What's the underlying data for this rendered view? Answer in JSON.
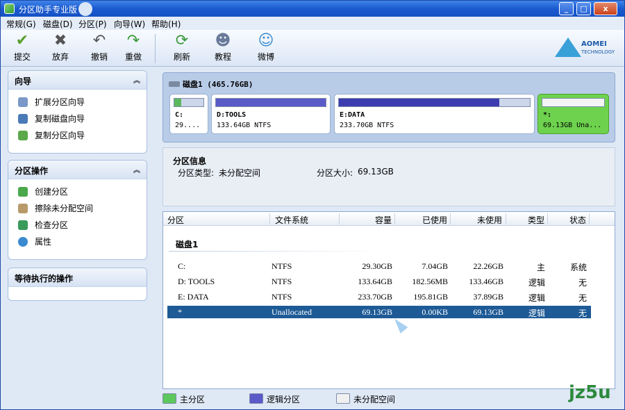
{
  "window": {
    "title": "分区助手专业版",
    "controls": [
      "_",
      "□",
      "x"
    ]
  },
  "menu": [
    "常规(G)",
    "磁盘(D)",
    "分区(P)",
    "向导(W)",
    "帮助(H)"
  ],
  "toolbar": [
    {
      "label": "提交",
      "icon": "check-icon"
    },
    {
      "label": "放弃",
      "icon": "x-icon"
    },
    {
      "label": "撤销",
      "icon": "undo-icon"
    },
    {
      "label": "重做",
      "icon": "redo-icon"
    },
    {
      "label": "刷新",
      "icon": "refresh-icon"
    },
    {
      "label": "教程",
      "icon": "tutorial-icon"
    },
    {
      "label": "微博",
      "icon": "weibo-icon"
    }
  ],
  "logo": {
    "line1": "AOMEI",
    "line2": "TECHNOLOGY"
  },
  "sidebar": {
    "wizard": {
      "title": "向导",
      "items": [
        "扩展分区向导",
        "复制磁盘向导",
        "复制分区向导"
      ]
    },
    "ops": {
      "title": "分区操作",
      "items": [
        "创建分区",
        "擦除未分配空间",
        "检查分区",
        "属性"
      ]
    },
    "pending": {
      "title": "等待执行的操作"
    }
  },
  "disk": {
    "title": "磁盘1  (465.76GB)",
    "partitions": [
      {
        "name": "C:",
        "size": "29....",
        "fill": 0.24,
        "color": "#5cb85c"
      },
      {
        "name": "D:TOOLS",
        "size": "133.64GB NTFS",
        "fill": 1.0,
        "color": "#5a5ac8"
      },
      {
        "name": "E:DATA",
        "size": "233.70GB NTFS",
        "fill": 0.84,
        "color": "#3c3cb0"
      },
      {
        "name": "*:",
        "size": "69.13GB Una...",
        "fill": 0.0,
        "color": "#ffffff"
      }
    ]
  },
  "info": {
    "title": "分区信息",
    "type_label": "分区类型:",
    "type_value": "未分配空间",
    "size_label": "分区大小:",
    "size_value": "69.13GB"
  },
  "table": {
    "headers": [
      "分区",
      "文件系统",
      "容量",
      "已使用",
      "未使用",
      "类型",
      "状态"
    ],
    "group": "磁盘1",
    "rows": [
      [
        "C:",
        "NTFS",
        "29.30GB",
        "7.04GB",
        "22.26GB",
        "主",
        "系统"
      ],
      [
        "D:  TOOLS",
        "NTFS",
        "133.64GB",
        "182.56MB",
        "133.46GB",
        "逻辑",
        "无"
      ],
      [
        "E:  DATA",
        "NTFS",
        "233.70GB",
        "195.81GB",
        "37.89GB",
        "逻辑",
        "无"
      ],
      [
        "*",
        "Unallocated",
        "69.13GB",
        "0.00KB",
        "69.13GB",
        "逻辑",
        "无"
      ]
    ]
  },
  "legend": [
    {
      "label": "主分区",
      "color": "#5cc85c"
    },
    {
      "label": "逻辑分区",
      "color": "#5a5ac8"
    },
    {
      "label": "未分配空间",
      "color": "#f0f0f0"
    }
  ],
  "watermark": "jz5u"
}
